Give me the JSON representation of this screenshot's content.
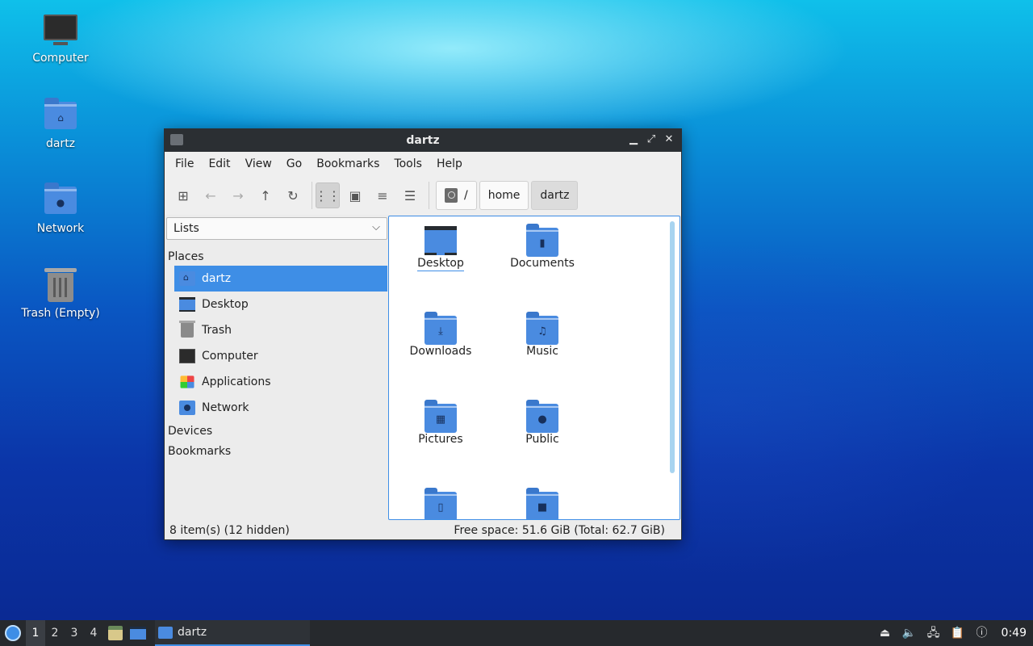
{
  "desktop": {
    "icons": [
      {
        "label": "Computer"
      },
      {
        "label": "dartz"
      },
      {
        "label": "Network"
      },
      {
        "label": "Trash (Empty)"
      }
    ]
  },
  "window": {
    "title": "dartz",
    "menus": [
      "File",
      "Edit",
      "View",
      "Go",
      "Bookmarks",
      "Tools",
      "Help"
    ],
    "path": {
      "root": "/",
      "crumbs": [
        "home",
        "dartz"
      ]
    },
    "sidebar": {
      "pane_type": "Lists",
      "sections": {
        "places": "Places",
        "devices": "Devices",
        "bookmarks": "Bookmarks"
      },
      "places": [
        {
          "label": "dartz",
          "icon": "home-folder-icon"
        },
        {
          "label": "Desktop",
          "icon": "desktop-icon"
        },
        {
          "label": "Trash",
          "icon": "trash-icon"
        },
        {
          "label": "Computer",
          "icon": "computer-icon"
        },
        {
          "label": "Applications",
          "icon": "applications-icon"
        },
        {
          "label": "Network",
          "icon": "network-icon"
        }
      ]
    },
    "files": [
      {
        "name": "Desktop",
        "icon": "desktop-folder-icon"
      },
      {
        "name": "Documents",
        "icon": "documents-folder-icon"
      },
      {
        "name": "Downloads",
        "icon": "downloads-folder-icon"
      },
      {
        "name": "Music",
        "icon": "music-folder-icon"
      },
      {
        "name": "Pictures",
        "icon": "pictures-folder-icon"
      },
      {
        "name": "Public",
        "icon": "public-folder-icon"
      },
      {
        "name": "",
        "icon": "templates-folder-icon"
      },
      {
        "name": "",
        "icon": "videos-folder-icon"
      }
    ],
    "status": {
      "items": "8 item(s) (12 hidden)",
      "free_space": "Free space: 51.6 GiB (Total: 62.7 GiB)"
    }
  },
  "taskbar": {
    "workspaces": [
      "1",
      "2",
      "3",
      "4"
    ],
    "active_workspace": "1",
    "task_label": "dartz",
    "clock": "0:49"
  },
  "colors": {
    "accent": "#3e8ee6",
    "folder": "#4a8be0",
    "titlebar": "#2b2f33",
    "taskbar": "#26292d"
  }
}
